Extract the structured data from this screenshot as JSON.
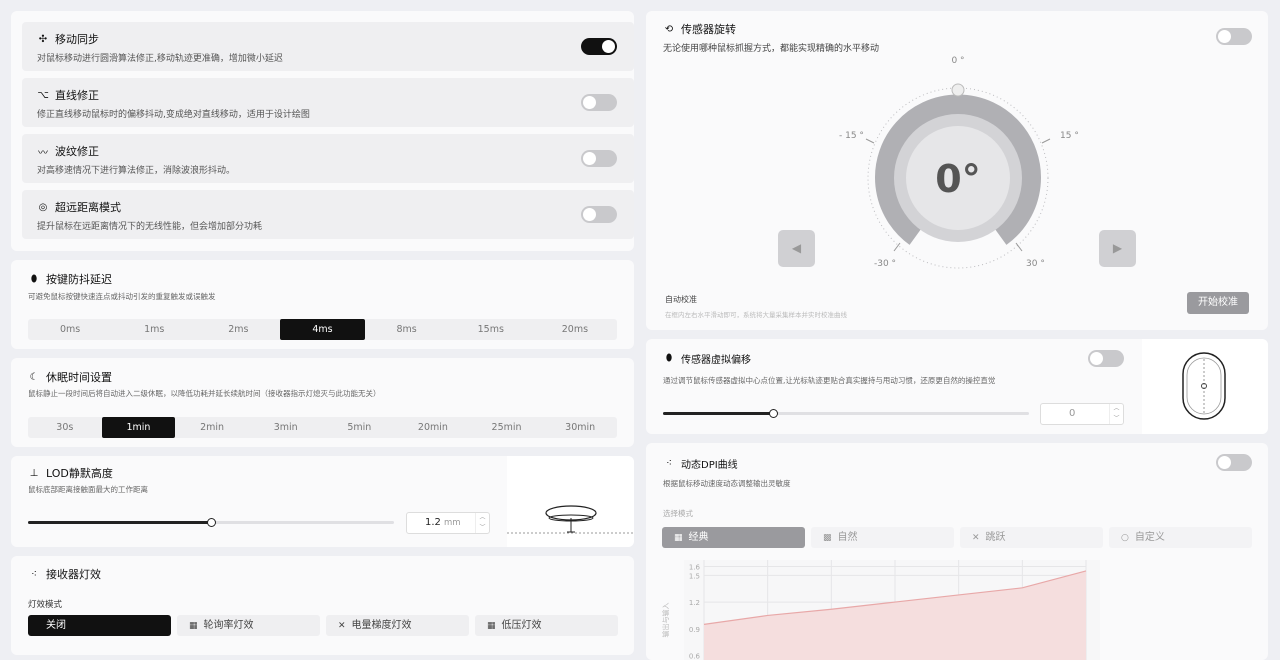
{
  "toggles": [
    {
      "icon": "✣",
      "title": "移动同步",
      "desc": "对鼠标移动进行圆滑算法修正,移动轨迹更准确，增加微小延迟",
      "on": true
    },
    {
      "icon": "⌥",
      "title": "直线修正",
      "desc": "修正直线移动鼠标时的偏移抖动,变成绝对直线移动，适用于设计绘图",
      "on": false
    },
    {
      "icon": "〰",
      "title": "波纹修正",
      "desc": "对高移速情况下进行算法修正，消除波浪形抖动。",
      "on": false
    },
    {
      "icon": "◎",
      "title": "超远距离模式",
      "desc": "提升鼠标在远距离情况下的无线性能，但会增加部分功耗",
      "on": false
    }
  ],
  "debounce": {
    "title": "按键防抖延迟",
    "desc": "可避免鼠标按键快速连点或抖动引发的重复触发或误触发",
    "options": [
      "0ms",
      "1ms",
      "2ms",
      "4ms",
      "8ms",
      "15ms",
      "20ms"
    ],
    "selected": "4ms"
  },
  "sleep": {
    "title": "休眠时间设置",
    "desc": "鼠标静止一段时间后将自动进入二级休眠，以降低功耗并延长续航时间（接收器指示灯熄灭与此功能无关）",
    "options": [
      "30s",
      "1min",
      "2min",
      "3min",
      "5min",
      "20min",
      "25min",
      "30min"
    ],
    "selected": "1min"
  },
  "lod": {
    "title": "LOD静默高度",
    "desc": "鼠标底部距离接触面最大的工作距离",
    "value": "1.2",
    "unit": "mm",
    "fraction": 0.5
  },
  "receiver": {
    "title": "接收器灯效",
    "mode_label": "灯效模式",
    "options": [
      {
        "icon": "",
        "label": "关闭"
      },
      {
        "icon": "▦",
        "label": "轮询率灯效"
      },
      {
        "icon": "✕",
        "label": "电量梯度灯效"
      },
      {
        "icon": "▦",
        "label": "低压灯效"
      }
    ],
    "selected": "关闭"
  },
  "rotation": {
    "title": "传感器旋转",
    "desc": "无论使用哪种鼠标抓握方式，都能实现精确的水平移动",
    "value": "0°",
    "ticks": [
      "0 °",
      "- 15 °",
      "15 °",
      "-30 °",
      "30 °"
    ],
    "auto_title": "自动校准",
    "auto_desc": "在框内左右水平滑动即可，系统将大量采集样本并实时校准曲线",
    "start_label": "开始校准"
  },
  "offset": {
    "title": "传感器虚拟偏移",
    "desc": "通过调节鼠标传感器虚拟中心点位置,让光标轨迹更贴合真实握持与甩动习惯，还原更自然的操控直觉",
    "value": "0",
    "fraction": 0.3
  },
  "dpi": {
    "title": "动态DPI曲线",
    "desc": "根据鼠标移动速度动态调整输出灵敏度",
    "mode_label": "选择模式",
    "options": [
      {
        "icon": "▦",
        "label": "经典"
      },
      {
        "icon": "▩",
        "label": "自然"
      },
      {
        "icon": "✕",
        "label": "跳跃"
      },
      {
        "icon": "○",
        "label": "自定义"
      }
    ],
    "selected": "经典",
    "ylabel": "输出与输入"
  },
  "chart_data": {
    "type": "area",
    "y_ticks": [
      1.6,
      1.5,
      1.2,
      0.9,
      0.6
    ],
    "x": [
      0,
      1,
      2,
      3,
      4,
      5,
      6
    ],
    "values": [
      0.95,
      1.05,
      1.12,
      1.2,
      1.28,
      1.36,
      1.55
    ],
    "ylim": [
      0.55,
      1.65
    ],
    "ylabel": "输出与输入",
    "grid": true
  }
}
